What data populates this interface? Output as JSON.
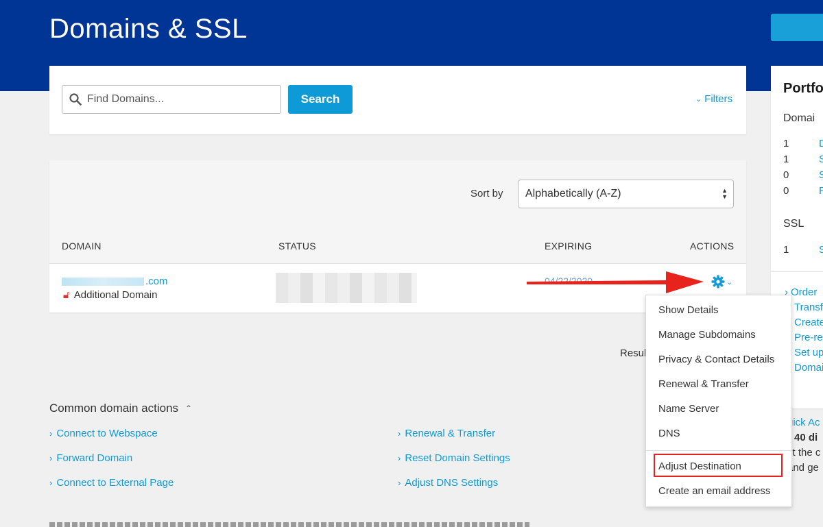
{
  "header": {
    "title": "Domains & SSL"
  },
  "search": {
    "placeholder": "Find Domains...",
    "button_label": "Search",
    "filters_label": "Filters"
  },
  "list": {
    "sort_label": "Sort by",
    "sort_value": "Alphabetically (A-Z)",
    "columns": [
      "DOMAIN",
      "STATUS",
      "EXPIRING",
      "ACTIONS"
    ],
    "row": {
      "domain_suffix": ".com",
      "type": "Additional Domain",
      "expiring": "04/22/2020"
    }
  },
  "results_label": "Resul",
  "action_menu": {
    "items": [
      "Show Details",
      "Manage Subdomains",
      "Privacy & Contact Details",
      "Renewal & Transfer",
      "Name Server",
      "DNS",
      "Adjust Destination",
      "Create an email address"
    ]
  },
  "common": {
    "title": "Common domain actions",
    "links_left": [
      "Connect to Webspace",
      "Forward Domain",
      "Connect to External Page"
    ],
    "links_right": [
      "Renewal & Transfer",
      "Reset Domain Settings",
      "Adjust DNS Settings"
    ]
  },
  "sidebar": {
    "title": "Portfo",
    "domains_label": "Domai",
    "domain_counts": [
      "1",
      "1",
      "0",
      "0"
    ],
    "domain_links": [
      "D",
      "S",
      "S",
      "F"
    ],
    "ssl_label": "SSL",
    "ssl_counts": [
      "1"
    ],
    "ssl_links": [
      "S"
    ],
    "action_links": [
      "Order",
      "Transf",
      "Create",
      "Pre-re",
      "Set up",
      "Domai"
    ],
    "quick": [
      "uick Ac",
      "r 40 di",
      "ct the c",
      "and ge"
    ]
  },
  "colors": {
    "header_blue": "#003595",
    "accent": "#0e9ad7",
    "highlight_red": "#e8231b"
  }
}
